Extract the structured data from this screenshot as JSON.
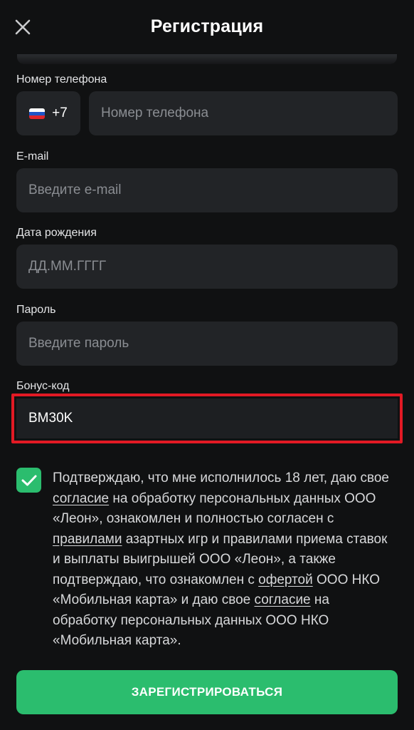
{
  "header": {
    "title": "Регистрация",
    "close_icon": "close-icon"
  },
  "phone": {
    "label": "Номер телефона",
    "country_code": "+7",
    "flag": "russia-flag-icon",
    "placeholder": "Номер телефона"
  },
  "email": {
    "label": "E-mail",
    "placeholder": "Введите e-mail"
  },
  "birthdate": {
    "label": "Дата рождения",
    "placeholder": "ДД.ММ.ГГГГ"
  },
  "password": {
    "label": "Пароль",
    "placeholder": "Введите пароль"
  },
  "bonus": {
    "label": "Бонус-код",
    "value": "BM30K"
  },
  "consent": {
    "checked": true,
    "parts": [
      "Подтверждаю, что мне исполнилось 18 лет, даю свое ",
      "согласие",
      " на обработку персональных данных ООО «Леон», ознакомлен и полностью согласен с ",
      "правилами",
      " азартных игр и правилами приема ставок и выплаты выигрышей ООО «Леон», а также подтверждаю, что ознакомлен с ",
      "офертой",
      " ООО НКО «Мобильная карта» и даю свое ",
      "согласие",
      " на обработку персональных данных ООО НКО «Мобильная карта»."
    ]
  },
  "submit_label": "ЗАРЕГИСТРИРОВАТЬСЯ",
  "colors": {
    "accent": "#2bbd6e",
    "highlight": "#e21a24",
    "background": "#101112",
    "field": "#222427"
  }
}
